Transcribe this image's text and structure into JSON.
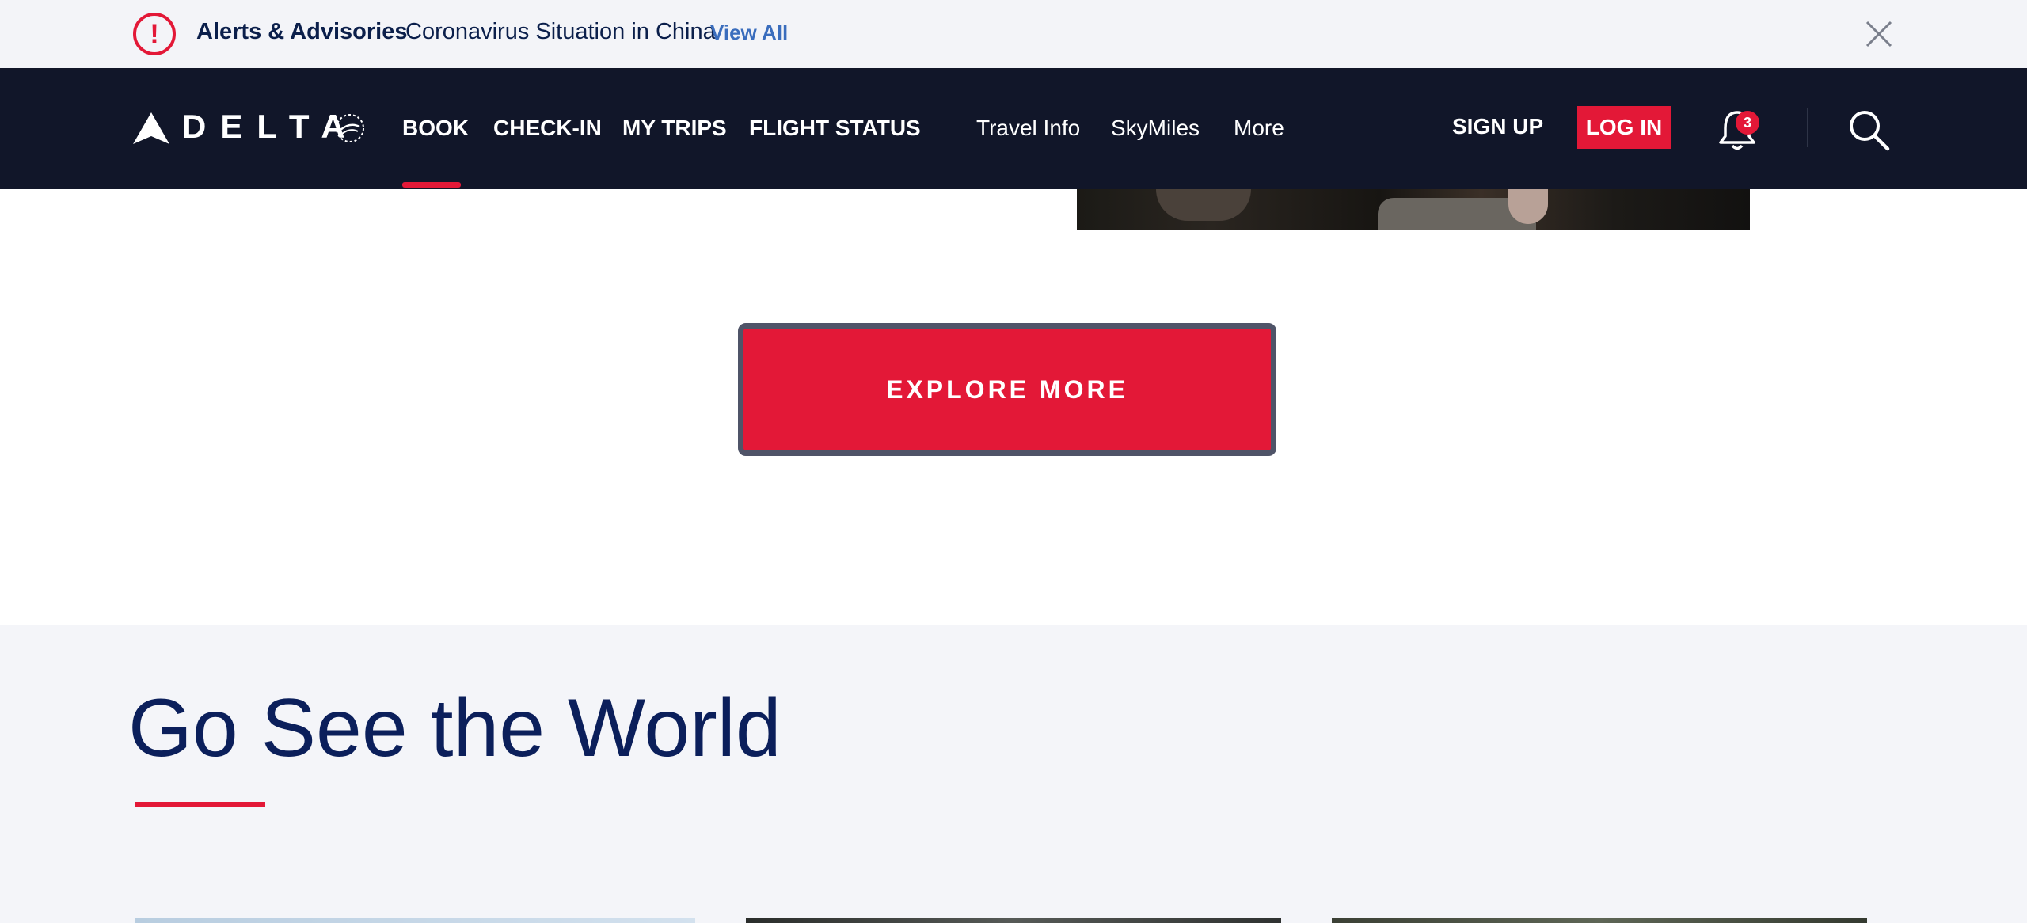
{
  "alert_bar": {
    "icon": "exclamation-circle-icon",
    "title": "Alerts & Advisories",
    "message": "Coronavirus Situation in China",
    "link": "View All",
    "close_icon": "close-icon"
  },
  "nav": {
    "logo_text": "DELTA",
    "primary": [
      {
        "label": "BOOK",
        "active": true
      },
      {
        "label": "CHECK-IN"
      },
      {
        "label": "MY TRIPS"
      },
      {
        "label": "FLIGHT STATUS"
      }
    ],
    "secondary": [
      {
        "label": "Travel Info"
      },
      {
        "label": "SkyMiles"
      },
      {
        "label": "More"
      }
    ],
    "sign_up": "SIGN UP",
    "log_in": "LOG IN",
    "notifications": {
      "icon": "bell-icon",
      "count": "3"
    },
    "search_icon": "search-icon"
  },
  "main": {
    "explore_button": "EXPLORE MORE"
  },
  "world_section": {
    "title": "Go See the World"
  },
  "colors": {
    "brand_red": "#e31837",
    "navy": "#111629",
    "title_blue": "#0b1f5b",
    "link_blue": "#3a6dbd"
  }
}
